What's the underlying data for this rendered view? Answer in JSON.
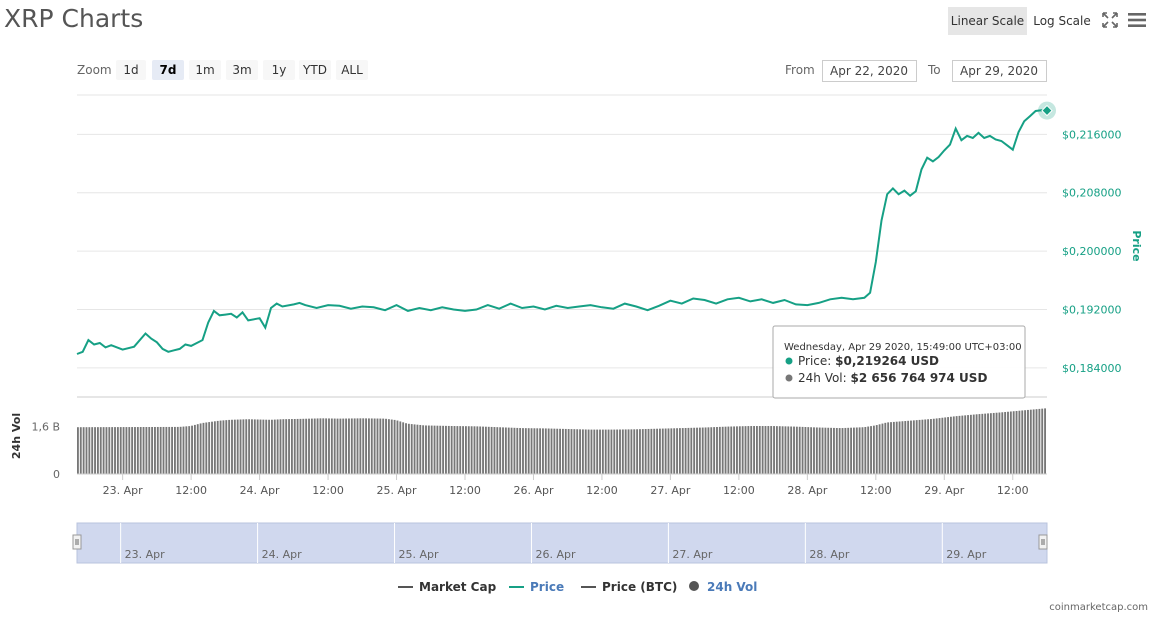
{
  "header": {
    "title": "XRP Charts",
    "linear_scale": "Linear Scale",
    "log_scale": "Log Scale"
  },
  "zoom": {
    "label": "Zoom",
    "buttons": [
      "1d",
      "7d",
      "1m",
      "3m",
      "1y",
      "YTD",
      "ALL"
    ],
    "active": "7d"
  },
  "range": {
    "from_label": "From",
    "from_value": "Apr 22, 2020",
    "to_label": "To",
    "to_value": "Apr 29, 2020"
  },
  "tooltip": {
    "header": "Wednesday, Apr 29 2020, 15:49:00 UTC+03:00",
    "price_label": "Price:",
    "price_value": "$0,219264 USD",
    "vol_label": "24h Vol:",
    "vol_value": "$2 656 764 974 USD"
  },
  "legend": [
    {
      "name": "Market Cap",
      "color": "#555555",
      "style": "line"
    },
    {
      "name": "Price",
      "color": "#16a085",
      "style": "line",
      "active": true
    },
    {
      "name": "Price (BTC)",
      "color": "#555555",
      "style": "line"
    },
    {
      "name": "24h Vol",
      "color": "#555555",
      "style": "dot",
      "active": true
    }
  ],
  "credit": "coinmarketcap.com",
  "colors": {
    "price_line": "#16a085",
    "volume_bar": "#777777",
    "navigator_fill": "#d0d8ee"
  },
  "chart_data": {
    "type": "line",
    "price_axis": {
      "title": "Price",
      "ylim": [
        0.18,
        0.2214
      ],
      "ticks": [
        0.184,
        0.192,
        0.2,
        0.208,
        0.216
      ],
      "tick_labels": [
        "$0,184000",
        "$0,192000",
        "$0,200000",
        "$0,208000",
        "$0,216000"
      ]
    },
    "volume_axis": {
      "title": "24h Vol",
      "ylim": [
        0,
        2.6
      ],
      "ticks": [
        0,
        1.6
      ],
      "tick_labels": [
        "0",
        "1,6 B"
      ]
    },
    "x_axis": {
      "range_hours": [
        -8,
        162
      ],
      "ticks": [
        {
          "hour": 0,
          "label": "23. Apr"
        },
        {
          "hour": 12,
          "label": "12:00"
        },
        {
          "hour": 24,
          "label": "24. Apr"
        },
        {
          "hour": 36,
          "label": "12:00"
        },
        {
          "hour": 48,
          "label": "25. Apr"
        },
        {
          "hour": 60,
          "label": "12:00"
        },
        {
          "hour": 72,
          "label": "26. Apr"
        },
        {
          "hour": 84,
          "label": "12:00"
        },
        {
          "hour": 96,
          "label": "27. Apr"
        },
        {
          "hour": 108,
          "label": "12:00"
        },
        {
          "hour": 120,
          "label": "28. Apr"
        },
        {
          "hour": 132,
          "label": "12:00"
        },
        {
          "hour": 144,
          "label": "29. Apr"
        },
        {
          "hour": 156,
          "label": "12:00"
        }
      ]
    },
    "navigator_ticks": [
      "23. Apr",
      "24. Apr",
      "25. Apr",
      "26. Apr",
      "27. Apr",
      "28. Apr",
      "29. Apr"
    ],
    "price_series": {
      "name": "Price",
      "hours": [
        -8,
        -7,
        -6,
        -5,
        -4,
        -3,
        -2,
        0,
        2,
        4,
        5,
        6,
        7,
        8,
        9,
        10,
        11,
        12,
        14,
        15,
        16,
        17,
        18,
        19,
        20,
        21,
        22,
        24,
        25,
        26,
        27,
        28,
        30,
        31,
        32,
        34,
        36,
        38,
        40,
        42,
        44,
        46,
        48,
        50,
        52,
        54,
        56,
        58,
        60,
        62,
        64,
        66,
        68,
        70,
        72,
        74,
        76,
        78,
        80,
        82,
        84,
        86,
        88,
        90,
        92,
        94,
        96,
        98,
        100,
        102,
        104,
        106,
        108,
        110,
        112,
        114,
        116,
        118,
        120,
        122,
        124,
        126,
        128,
        130,
        131,
        132,
        133,
        134,
        135,
        136,
        137,
        138,
        139,
        140,
        141,
        142,
        143,
        144,
        145,
        146,
        147,
        148,
        149,
        150,
        151,
        152,
        153,
        154,
        155,
        156,
        157,
        158,
        159,
        160,
        161,
        162
      ],
      "values": [
        0.1859,
        0.1862,
        0.1878,
        0.1872,
        0.1874,
        0.1868,
        0.1871,
        0.1865,
        0.1869,
        0.1887,
        0.188,
        0.1875,
        0.1866,
        0.1862,
        0.1864,
        0.1866,
        0.1872,
        0.187,
        0.1878,
        0.1902,
        0.1918,
        0.1912,
        0.1913,
        0.1914,
        0.1909,
        0.1916,
        0.1905,
        0.1908,
        0.1895,
        0.1922,
        0.1928,
        0.1924,
        0.1927,
        0.1929,
        0.1926,
        0.1922,
        0.1926,
        0.1925,
        0.1921,
        0.1924,
        0.1923,
        0.1919,
        0.1926,
        0.1918,
        0.1922,
        0.1919,
        0.1923,
        0.192,
        0.1918,
        0.192,
        0.1926,
        0.1921,
        0.1928,
        0.1922,
        0.1924,
        0.192,
        0.1925,
        0.1922,
        0.1924,
        0.1926,
        0.1923,
        0.1921,
        0.1928,
        0.1924,
        0.1919,
        0.1925,
        0.1932,
        0.1928,
        0.1935,
        0.1933,
        0.1928,
        0.1934,
        0.1936,
        0.1931,
        0.1934,
        0.1929,
        0.1933,
        0.1927,
        0.1926,
        0.1929,
        0.1934,
        0.1936,
        0.1934,
        0.1936,
        0.1943,
        0.1985,
        0.2042,
        0.2078,
        0.2086,
        0.2078,
        0.2083,
        0.2076,
        0.2082,
        0.2112,
        0.2128,
        0.2123,
        0.2129,
        0.2138,
        0.2146,
        0.2168,
        0.2152,
        0.2158,
        0.2155,
        0.2162,
        0.2155,
        0.2158,
        0.2153,
        0.2151,
        0.2145,
        0.2139,
        0.2163,
        0.2178,
        0.2185,
        0.2192,
        0.2193,
        0.219264
      ]
    },
    "volume_series": {
      "name": "24h Vol",
      "hours": [
        -8,
        10,
        12,
        14,
        17,
        19,
        22,
        24,
        26,
        28,
        31,
        35,
        38,
        42,
        46,
        48,
        50,
        53,
        58,
        62,
        66,
        70,
        74,
        78,
        82,
        86,
        90,
        94,
        98,
        102,
        106,
        110,
        114,
        118,
        122,
        126,
        130,
        132,
        134,
        138,
        142,
        146,
        150,
        154,
        158,
        162
      ],
      "values": [
        1.58,
        1.59,
        1.62,
        1.72,
        1.8,
        1.83,
        1.85,
        1.84,
        1.83,
        1.85,
        1.86,
        1.88,
        1.87,
        1.88,
        1.87,
        1.82,
        1.7,
        1.64,
        1.62,
        1.61,
        1.58,
        1.55,
        1.54,
        1.52,
        1.5,
        1.5,
        1.51,
        1.53,
        1.55,
        1.57,
        1.6,
        1.62,
        1.62,
        1.6,
        1.57,
        1.55,
        1.58,
        1.64,
        1.74,
        1.8,
        1.86,
        1.95,
        2.02,
        2.08,
        2.15,
        2.22
      ]
    },
    "grid": true,
    "legend_position": "bottom-center"
  }
}
